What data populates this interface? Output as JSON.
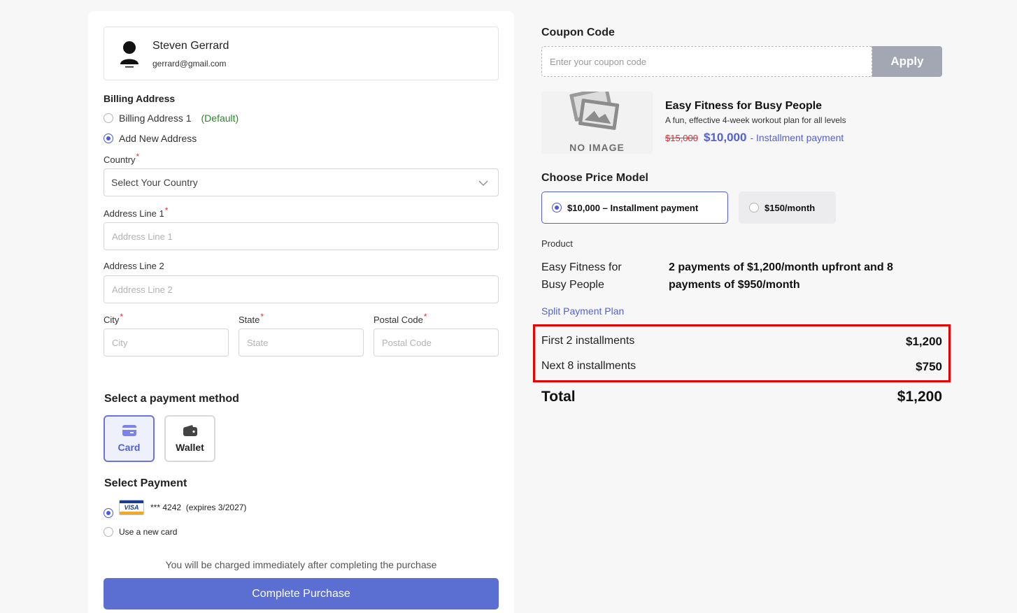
{
  "user": {
    "name": "Steven Gerrard",
    "email": "gerrard@gmail.com"
  },
  "billing": {
    "title": "Billing Address",
    "options": [
      {
        "label": "Billing Address 1",
        "tag": "(Default)",
        "checked": false
      },
      {
        "label": "Add New Address",
        "checked": true
      }
    ]
  },
  "form": {
    "country_label": "Country",
    "country_value": "Select Your Country",
    "address1_label": "Address Line 1",
    "address1_placeholder": "Address Line 1",
    "address2_label": "Address Line 2",
    "address2_placeholder": "Address Line 2",
    "city_label": "City",
    "city_placeholder": "City",
    "state_label": "State",
    "state_placeholder": "State",
    "postal_label": "Postal Code",
    "postal_placeholder": "Postal Code",
    "required_mark": "*"
  },
  "payment_method": {
    "title": "Select a payment method",
    "methods": [
      {
        "label": "Card",
        "icon": "credit-card-icon",
        "active": true
      },
      {
        "label": "Wallet",
        "icon": "wallet-icon",
        "active": false
      }
    ]
  },
  "select_payment": {
    "title": "Select Payment",
    "saved_card": {
      "brand": "VISA",
      "text": "*** 4242  (expires 3/2027)",
      "checked": true
    },
    "new_card": {
      "label": "Use a new card",
      "checked": false
    }
  },
  "footer": {
    "note": "You will be charged immediately after completing the purchase",
    "complete_label": "Complete Purchase"
  },
  "coupon": {
    "title": "Coupon Code",
    "placeholder": "Enter your coupon code",
    "apply_label": "Apply"
  },
  "product": {
    "image_text": "NO IMAGE",
    "title": "Easy Fitness for Busy People",
    "description": "A fun, effective 4-week workout plan for all levels",
    "old_price": "$15,000",
    "new_price": "$10,000",
    "price_type": "- Installment payment"
  },
  "price_model": {
    "title": "Choose Price Model",
    "options": [
      {
        "label": "$10,000 – Installment payment",
        "checked": true
      },
      {
        "label": "$150/month",
        "checked": false
      }
    ]
  },
  "summary": {
    "product_label": "Product",
    "product_name": "Easy Fitness for Busy People",
    "plan_text": "2 payments of $1,200/month upfront and 8 payments of $950/month",
    "split_label": "Split Payment Plan",
    "installments": [
      {
        "label": "First 2 installments",
        "amount": "$1,200"
      },
      {
        "label": "Next 8 installments",
        "amount": "$750"
      }
    ],
    "total_label": "Total",
    "total_value": "$1,200"
  },
  "colors": {
    "accent": "#5360d6",
    "button": "#5b6fd2",
    "highlight": "#e60000",
    "default_tag": "#2a8a2a"
  }
}
